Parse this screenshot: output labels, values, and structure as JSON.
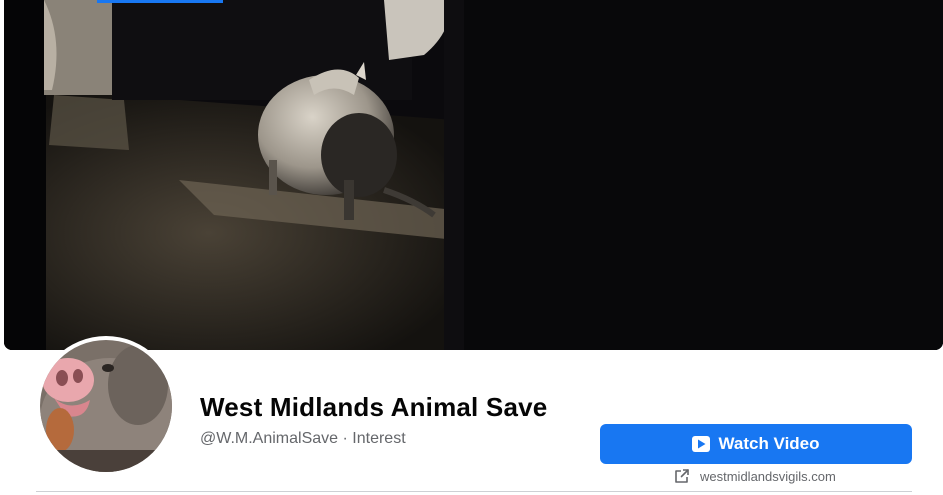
{
  "page": {
    "name": "West Midlands Animal Save",
    "handle": "@W.M.AnimalSave",
    "separator": " · ",
    "category": "Interest"
  },
  "actions": {
    "watch_video_label": "Watch Video",
    "watch_video_icon": "video-play-icon"
  },
  "website": {
    "label": "westmidlandsvigils.com",
    "icon": "external-link-icon"
  },
  "colors": {
    "accent": "#1877f2",
    "text_primary": "#050505",
    "text_secondary": "#65676b"
  }
}
